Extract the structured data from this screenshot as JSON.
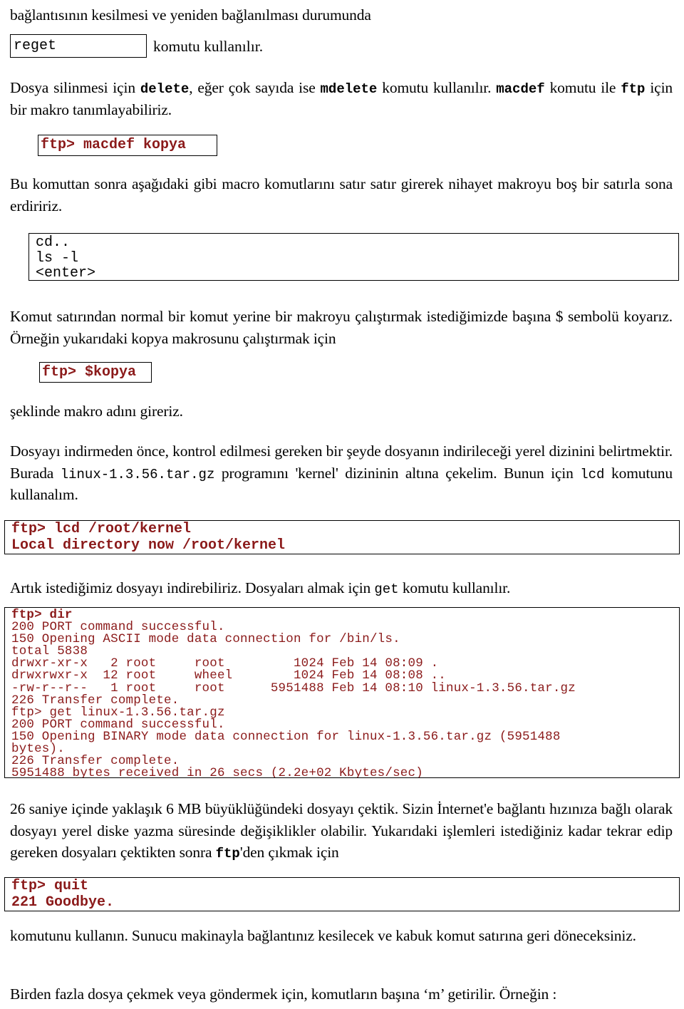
{
  "document": {
    "language": "tr",
    "colors": {
      "terminal_text": "#8B1A1A",
      "body_text": "#000000",
      "box_border": "#000000",
      "page_background": "#FFFFFF"
    }
  },
  "paragraphs": {
    "intro": "bağlantısının kesilmesi ve yeniden bağlanılması durumunda",
    "reget_after": "komutu kullanılır.",
    "delete_1": "Dosya silinmesi için ",
    "delete_code_1": "delete",
    "delete_2": ", eğer çok sayıda ise ",
    "delete_code_2": "mdelete",
    "delete_3": " komutu kullanılır. ",
    "delete_code_3": "macdef",
    "delete_4": " komutu ile ",
    "delete_code_4": "ftp",
    "delete_5": " için bir makro tanımlayabiliriz.",
    "macro": "Bu komuttan sonra aşağıdaki gibi macro komutlarını satır satır girerek nihayet makroyu boş bir satırla sona erdiririz.",
    "makro": "Komut satırından normal bir komut yerine bir makroyu çalıştırmak istediğimizde başına $ sembolü koyarız. Örneğin yukarıdaki  kopya makrosunu çalıştırmak için",
    "seklinde": "şeklinde makro adını gireriz.",
    "dosya_1": "Dosyayı indirmeden önce, kontrol edilmesi gereken bir şeyde dosyanın indirileceği yerel dizinini belirtmektir. Burada ",
    "dosya_code_1": "linux-1.3.56.tar.gz",
    "dosya_2": " programını 'kernel' dizininin altına çekelim. Bunun için ",
    "dosya_code_2": "lcd",
    "dosya_3": " komutunu kullanalım.",
    "artik_1": "Artık istediğimiz dosyayı indirebiliriz. Dosyaları almak için ",
    "artik_code": "get",
    "artik_2": " komutu kullanılır.",
    "saniye_1": "26 saniye içinde yaklaşık 6 MB büyüklüğündeki dosyayı çektik. Sizin İnternet'e bağlantı hızınıza bağlı olarak dosyayı yerel diske yazma süresinde değişiklikler olabilir. Yukarıdaki işlemleri istediğiniz kadar tekrar edip gereken dosyaları çektikten sonra ",
    "saniye_code": "ftp",
    "saniye_2": "'den çıkmak için",
    "komutunu": "komutunu kullanın. Sunucu makinayla bağlantınız kesilecek ve kabuk komut satırına geri döneceksiniz.",
    "birden": "Birden fazla dosya çekmek veya göndermek için, komutların başına ‘m’ getirilir. Örneğin :"
  },
  "code_boxes": {
    "reget": {
      "lines": [
        "reget"
      ],
      "color": "#000000"
    },
    "macdef": {
      "lines": [
        "ftp> macdef kopya"
      ],
      "color": "#8B1A1A"
    },
    "macro_body": {
      "lines": [
        "cd..",
        "ls -l",
        "<enter>"
      ],
      "color": "#000000"
    },
    "kopya": {
      "lines": [
        "ftp> $kopya"
      ],
      "color": "#8B1A1A"
    },
    "lcd": {
      "lines": [
        "ftp> lcd /root/kernel",
        "Local directory now /root/kernel"
      ],
      "color": "#8B1A1A"
    },
    "terminal": {
      "color": "#8B1A1A",
      "prompt_line": "ftp> dir",
      "lines": [
        "200 PORT command successful.",
        "150 Opening ASCII mode data connection for /bin/ls.",
        "total 5838",
        "drwxr-xr-x   2 root     root         1024 Feb 14 08:09 .",
        "drwxrwxr-x  12 root     wheel        1024 Feb 14 08:08 ..",
        "-rw-r--r--   1 root     root      5951488 Feb 14 08:10 linux-1.3.56.tar.gz",
        "226 Transfer complete.",
        "ftp> get linux-1.3.56.tar.gz",
        "200 PORT command successful.",
        "150 Opening BINARY mode data connection for linux-1.3.56.tar.gz (5951488",
        "bytes).",
        "226 Transfer complete.",
        "5951488 bytes received in 26 secs (2.2e+02 Kbytes/sec)"
      ]
    },
    "quit": {
      "lines": [
        "ftp> quit",
        "221 Goodbye."
      ],
      "color": "#8B1A1A"
    }
  }
}
